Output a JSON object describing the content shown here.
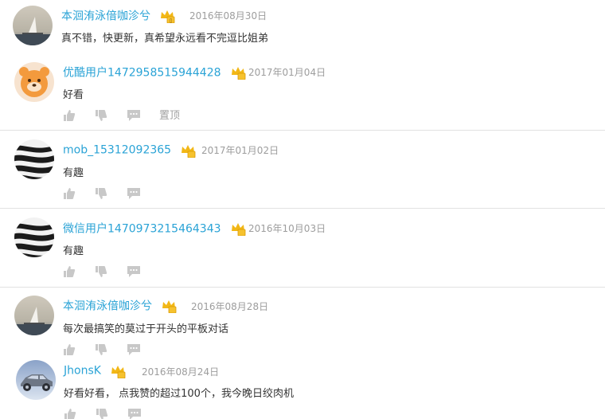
{
  "comments": [
    {
      "username": "本洄洧泳偣咖沴兮",
      "timestamp": "2016年08月30日",
      "content": "真不错，快更新，真希望永远看不完逗比姐弟",
      "avatar": "seaside-photo-avatar",
      "pin_label": ""
    },
    {
      "username": "优酷用户1472958515944428",
      "timestamp": "2017年01月04日",
      "content": "好看",
      "avatar": "orange-bear-avatar",
      "pin_label": "置顶"
    },
    {
      "username": "mob_15312092365",
      "timestamp": "2017年01月02日",
      "content": "有趣",
      "avatar": "zebra-stripes-avatar",
      "pin_label": ""
    },
    {
      "username": "微信用户1470973215464343",
      "timestamp": "2016年10月03日",
      "content": "有趣",
      "avatar": "zebra-stripes-avatar",
      "pin_label": ""
    },
    {
      "username": "本洄洧泳偣咖沴兮",
      "timestamp": "2016年08月28日",
      "content": "每次最搞笑的莫过于开头的平板对话",
      "avatar": "seaside-photo-avatar",
      "pin_label": ""
    },
    {
      "username": "JhonsK",
      "timestamp": "2016年08月24日",
      "content": "好看好看， 点我赞的超过100个，我今晚日绞肉机",
      "avatar": "vintage-car-avatar",
      "pin_label": ""
    }
  ],
  "icons": {
    "like": "thumbs-up-icon",
    "dislike": "thumbs-down-icon",
    "reply": "speech-bubble-icon",
    "vip": "vip-crown-badge-icon"
  },
  "colors": {
    "username": "#2aa3d6",
    "timestamp": "#9d9d9d",
    "content": "#333333",
    "action_icon": "#c8c8c8",
    "badge_gold": "#f2b716",
    "divider": "#e2e2e2"
  }
}
